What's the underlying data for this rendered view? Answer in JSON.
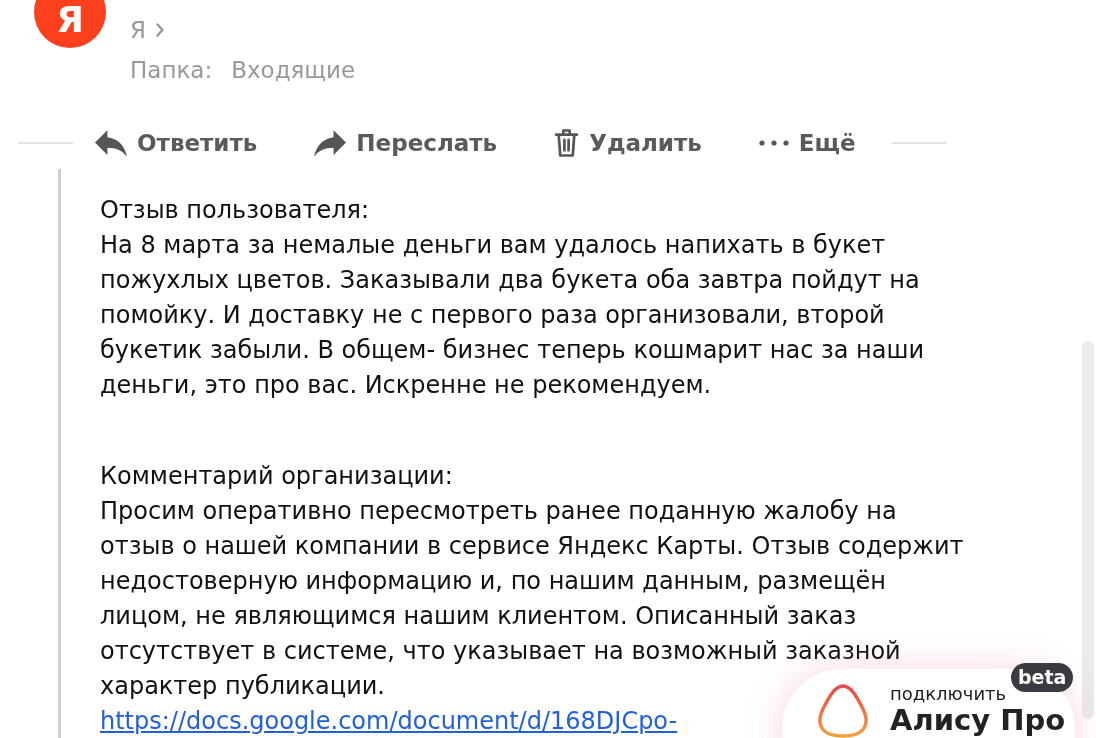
{
  "sender": {
    "avatar_letter": "Я",
    "recipient": "Я",
    "folder_label": "Папка:",
    "folder": "Входящие"
  },
  "toolbar": [
    {
      "kind": "reply",
      "label": "Ответить"
    },
    {
      "kind": "forward",
      "label": "Переслать"
    },
    {
      "kind": "delete",
      "label": "Удалить"
    },
    {
      "kind": "more",
      "label": "Ещё"
    }
  ],
  "message": {
    "sections": [
      {
        "heading": "Отзыв пользователя:",
        "lines": [
          "На 8 марта за немалые деньги вам удалось напихать в букет",
          "пожухлых цветов. Заказывали два букета оба завтра пойдут на",
          "помойку. И доставку не с первого раза организовали, второй",
          "букетик забыли. В общем- бизнес теперь кошмарит нас за наши",
          "деньги, это про вас. Искренне не рекомендуем."
        ]
      },
      {
        "heading": "Комментарий организации:",
        "lines": [
          "Просим оперативно пересмотреть ранее поданную жалобу на",
          "отзыв о нашей компании в сервисе Яндекс Карты. Отзыв содержит",
          "недостоверную информацию и, по нашим данным, размещён",
          "лицом, не являющимся нашим клиентом. Описанный заказ",
          "отсутствует в системе, что указывает на возможный заказной",
          "характер публикации."
        ]
      }
    ],
    "link": "https://docs.google.com/document/d/168DJCpo-"
  },
  "promo": {
    "caption": "подключить",
    "title": "Алису Про",
    "badge": "beta"
  }
}
